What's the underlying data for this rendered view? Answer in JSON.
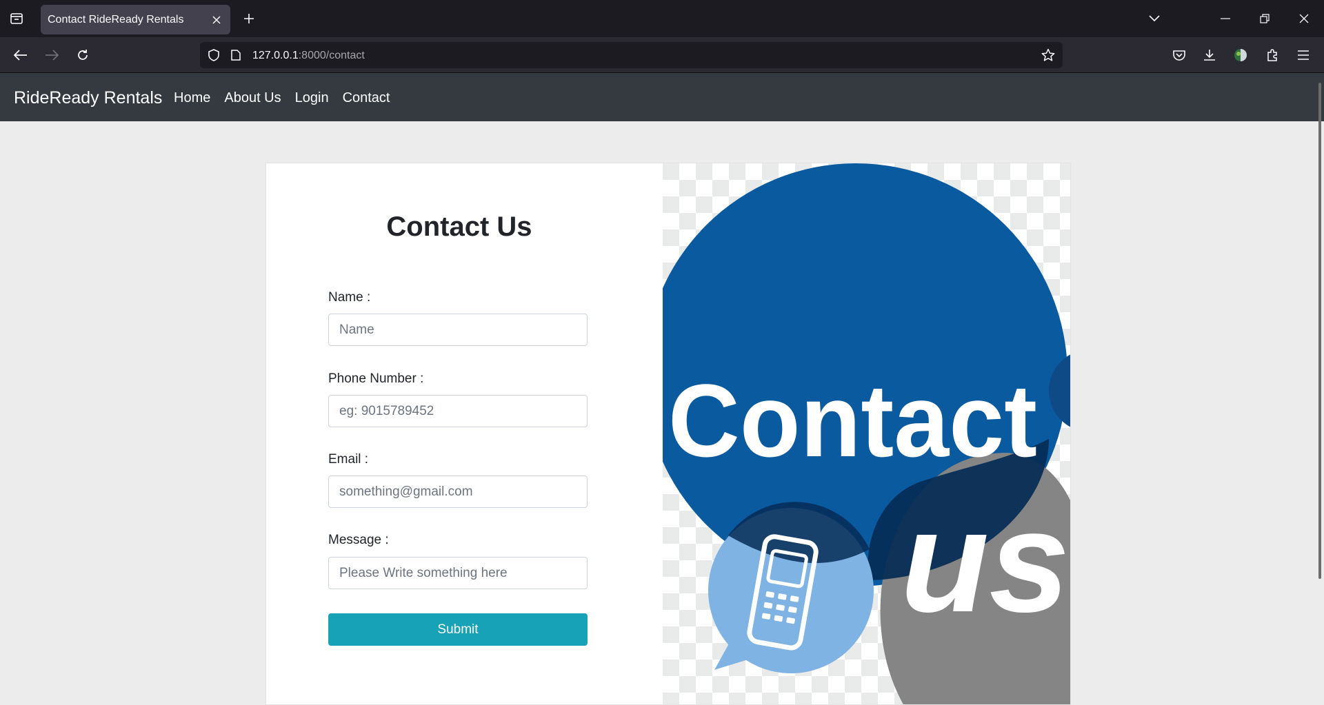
{
  "browser": {
    "tab_title": "Contact RideReady Rentals",
    "url_host": "127.0.0.1",
    "url_rest": ":8000/contact"
  },
  "site": {
    "brand": "RideReady Rentals",
    "nav": [
      "Home",
      "About Us",
      "Login",
      "Contact"
    ]
  },
  "form": {
    "title": "Contact Us",
    "name_label": "Name :",
    "name_placeholder": "Name",
    "phone_label": "Phone Number :",
    "phone_placeholder": "eg: 9015789452",
    "email_label": "Email :",
    "email_placeholder": "something@gmail.com",
    "message_label": "Message :",
    "message_placeholder": "Please Write something here",
    "submit_label": "Submit"
  },
  "image": {
    "word1": "Contact",
    "word2": "us"
  },
  "colors": {
    "navbar": "#343a40",
    "accent": "#17a2b8",
    "bubble_blue": "#0a5aa0",
    "bubble_dark": "#052c55",
    "bubble_gray": "#858585",
    "bubble_light": "#7fb3e3"
  }
}
